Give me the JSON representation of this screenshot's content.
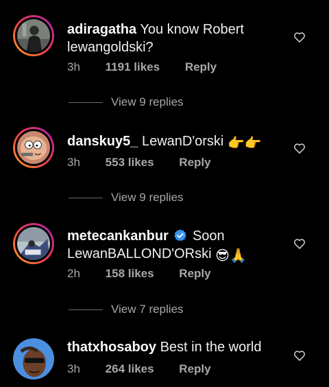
{
  "comments": [
    {
      "username": "adiragatha",
      "text": "You know Robert lewangoldski?",
      "time": "3h",
      "likes": "1191 likes",
      "reply": "Reply",
      "view_replies": "View 9 replies"
    },
    {
      "username": "danskuy5_",
      "text": "LewanD'orski",
      "emoji": "👉👉",
      "time": "3h",
      "likes": "553 likes",
      "reply": "Reply",
      "view_replies": "View 9 replies"
    },
    {
      "username": "metecankanbur",
      "verified": true,
      "text_line1": "Soon",
      "text_line2": "LewanBALLOND'ORski",
      "emoji": "😎🙏",
      "time": "2h",
      "likes": "158 likes",
      "reply": "Reply",
      "view_replies": "View 7 replies"
    },
    {
      "username": "thatxhosaboy",
      "text": "Best in the world",
      "time": "3h",
      "likes": "264 likes",
      "reply": "Reply"
    }
  ],
  "colors": {
    "background": "#000000",
    "secondary_text": "#a8a8a8",
    "verified": "#3897f0",
    "story_ring_start": "#f9a31a",
    "story_ring_end": "#8f3bb5"
  },
  "icons": [
    "heart-outline-icon",
    "verified-badge-icon"
  ]
}
